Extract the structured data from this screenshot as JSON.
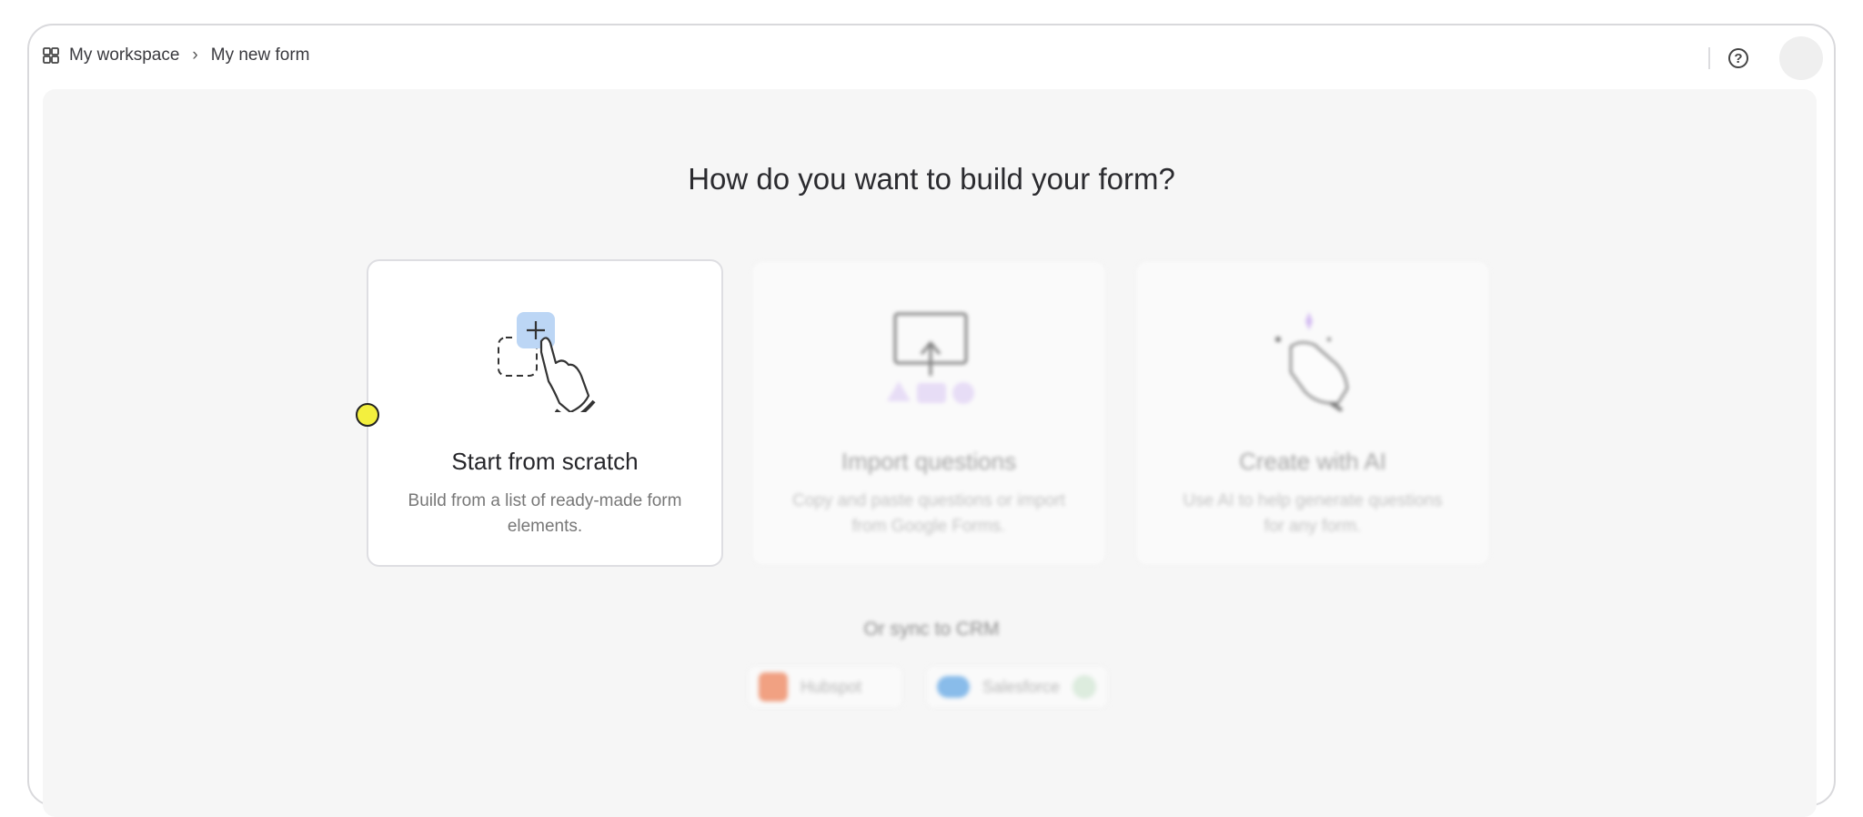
{
  "breadcrumb": {
    "workspace": "My workspace",
    "separator": "›",
    "form": "My new form"
  },
  "help_label": "?",
  "heading": "How do you want to build your form?",
  "options": [
    {
      "title": "Start from scratch",
      "description": "Build from a list of ready-made form elements."
    },
    {
      "title": "Import questions",
      "description": "Copy and paste questions or import from Google Forms."
    },
    {
      "title": "Create with AI",
      "description": "Use AI to help generate questions for any form."
    }
  ],
  "crm": {
    "label": "Or sync to CRM",
    "items": [
      {
        "label": "Hubspot"
      },
      {
        "label": "Salesforce"
      }
    ]
  },
  "colors": {
    "canvas": "#f6f6f6",
    "accent_blue": "#bcd6f5",
    "accent_purple": "#e3d5f7",
    "cursor": "#f3ef3e"
  }
}
